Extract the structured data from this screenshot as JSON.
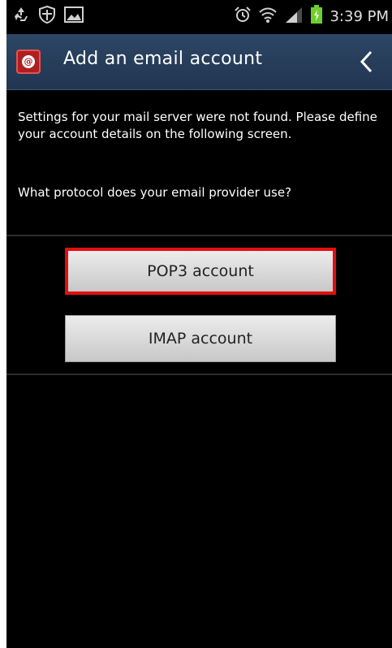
{
  "status_bar": {
    "time": "3:39 PM",
    "left_icons": [
      "recycle-icon",
      "shield-icon",
      "gallery-icon"
    ],
    "right_icons": [
      "alarm-icon",
      "wifi-icon",
      "signal-icon",
      "battery-icon"
    ]
  },
  "header": {
    "title": "Add an email account",
    "app_icon": "email-app-icon",
    "back_icon": "back-chevron-icon"
  },
  "main": {
    "message": "Settings for your mail server were not found. Please define your account details on the following screen.",
    "question": "What protocol does your email provider use?",
    "options": [
      {
        "label": "POP3 account",
        "highlighted": true
      },
      {
        "label": "IMAP account",
        "highlighted": false
      }
    ]
  },
  "colors": {
    "title_bar": "#2d4766",
    "highlight_border": "#e20f0f",
    "background": "#000000"
  }
}
